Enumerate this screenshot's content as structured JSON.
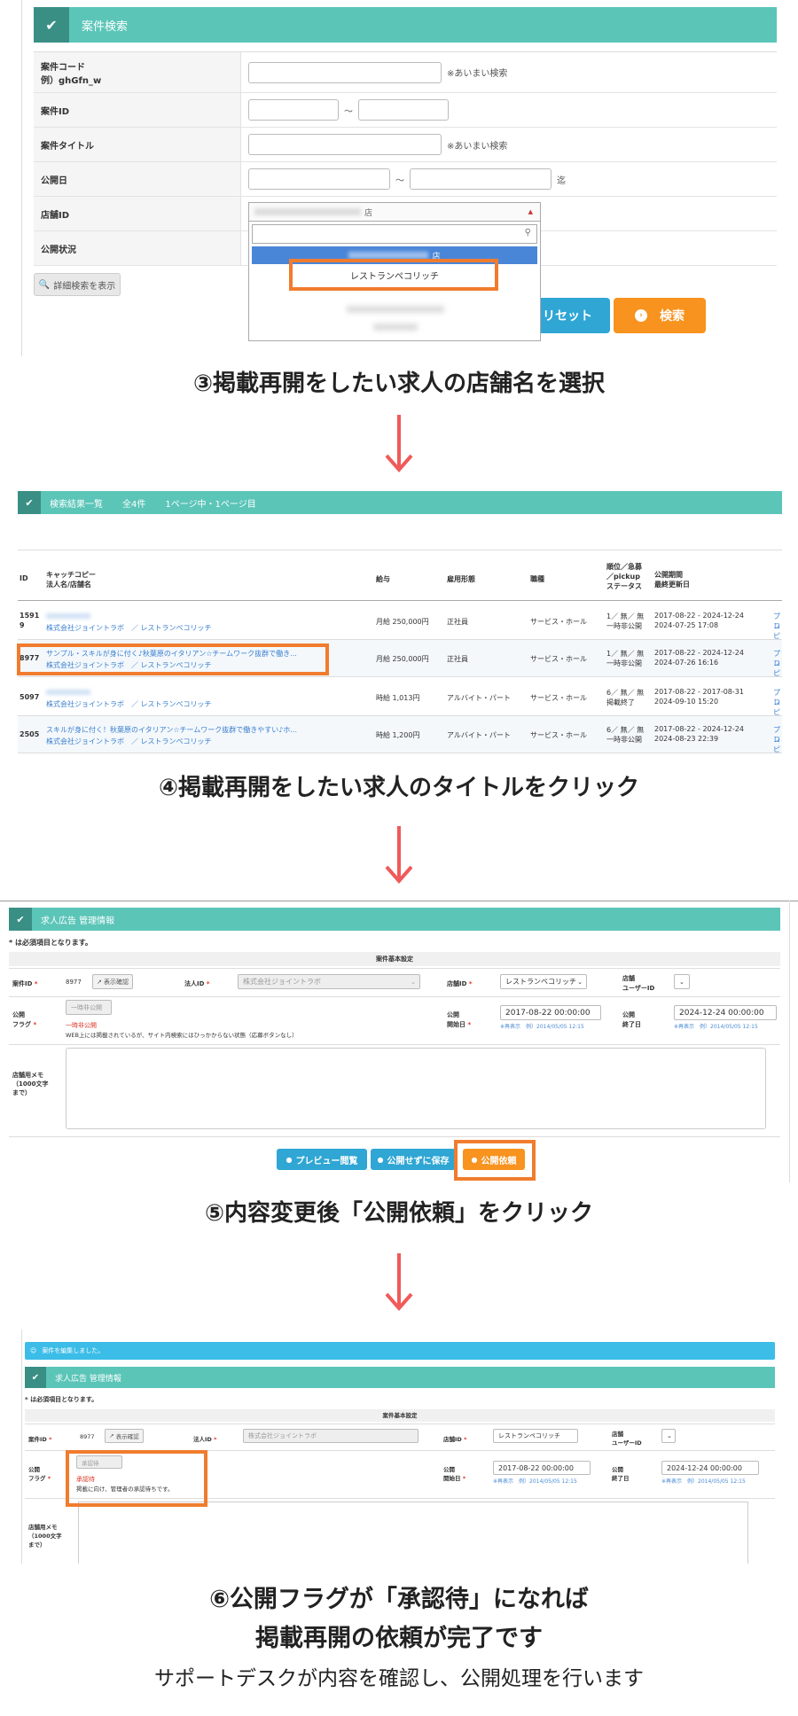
{
  "section1": {
    "header": "案件検索",
    "rows": [
      {
        "label": "案件コード",
        "label2": "例）ghGfn_w",
        "note": "※あいまい検索"
      },
      {
        "label": "案件ID",
        "sep": "～"
      },
      {
        "label": "案件タイトル",
        "note": "※あいまい検索"
      },
      {
        "label": "公開日",
        "sep": "～",
        "note": "迄"
      },
      {
        "label": "店舗ID"
      },
      {
        "label": "公開状況"
      }
    ],
    "store_select_value": "店",
    "dropdown_selected": "店",
    "dropdown_option": "レストランペコリッチ",
    "detail_search_button": "詳細検索を表示",
    "reset_button": "リセット",
    "search_button": "検索"
  },
  "caption3": "③掲載再開をしたい求人の店舗名を選択",
  "section2": {
    "header": {
      "title": "検索結果一覧",
      "total": "全4件",
      "pages": "1ページ中・1ページ目"
    },
    "columns": {
      "id": "ID",
      "catch": "キャッチコピー",
      "catch2": "法人名/店舗名",
      "salary": "給与",
      "employment": "雇用形態",
      "job": "職種",
      "rank1": "順位／急募",
      "rank2": "／pickup",
      "rank3": "ステータス",
      "period1": "公開期間",
      "period2": "最終更新日"
    },
    "rows": [
      {
        "id1": "1591",
        "id2": "9",
        "title": "",
        "corp": "株式会社ジョイントラボ　／ レストランペコリッチ",
        "salary": "月給 250,000円",
        "employment": "正社員",
        "job": "サービス・ホール",
        "rank": "1／ 無／ 無",
        "status": "一時非公開",
        "period": "2017-08-22 - 2024-12-24",
        "updated": "2024-07-25 17:08",
        "side": "プレ",
        "side2": "コピ"
      },
      {
        "id1": "8977",
        "id2": "",
        "title": "サンプル・スキルが身に付く♪秋葉原のイタリアン☆チームワーク抜群で働き...",
        "corp": "株式会社ジョイントラボ　／ レストランペコリッチ",
        "salary": "月給 250,000円",
        "employment": "正社員",
        "job": "サービス・ホール",
        "rank": "1／ 無／ 無",
        "status": "一時非公開",
        "period": "2017-08-22 - 2024-12-24",
        "updated": "2024-07-26 16:16",
        "side": "プレ",
        "side2": "コピ"
      },
      {
        "id1": "5097",
        "id2": "",
        "title": "",
        "corp": "株式会社ジョイントラボ　／ レストランペコリッチ",
        "salary": "時給 1,013円",
        "employment": "アルバイト・パート",
        "job": "サービス・ホール",
        "rank": "6／ 無／ 無",
        "status": "掲載終了",
        "period": "2017-08-22 - 2017-08-31",
        "updated": "2024-09-10 15:20",
        "side": "プレ",
        "side2": "コピ"
      },
      {
        "id1": "2505",
        "id2": "",
        "title": "スキルが身に付く！秋葉原のイタリアン☆チームワーク抜群で働きやすい♪ホ...",
        "corp": "株式会社ジョイントラボ　／ レストランペコリッチ",
        "salary": "時給 1,200円",
        "employment": "アルバイト・パート",
        "job": "サービス・ホール",
        "rank": "6／ 無／ 無",
        "status": "一時非公開",
        "period": "2017-08-22 - 2024-12-24",
        "updated": "2024-08-23 22:39",
        "side": "プレ",
        "side2": "コピ"
      }
    ]
  },
  "caption4": "④掲載再開をしたい求人のタイトルをクリック",
  "section3": {
    "header": "求人広告 管理情報",
    "required_note": "* は必須項目となります。",
    "table_title": "案件基本設定",
    "job_id_label": "案件ID",
    "job_id": "8977",
    "view_button": "表示確認",
    "corp_id_label": "法人ID",
    "corp_value": "株式会社ジョイントラボ",
    "store_id_label": "店舗ID",
    "store_value": "レストランペコリッチ",
    "store_user_label1": "店舗",
    "store_user_label2": "ユーザーID",
    "flag_label1": "公開",
    "flag_label2": "フラグ",
    "flag_select": "一時非公開",
    "flag_status": "一時非公開",
    "flag_desc": "WEB上には掲載されているが、サイト内検索にはひっかからない状態（応募ボタンなし）",
    "start_label1": "公開",
    "start_label2": "開始日",
    "start_value": "2017-08-22 00:00:00",
    "end_label1": "公開",
    "end_label2": "終了日",
    "end_value": "2024-12-24 00:00:00",
    "date_hint": "※再表示　例）2014/05/05 12:15",
    "memo_label": "店舗用メモ（1000文字まで）",
    "preview_button": "プレビュー閲覧",
    "save_button": "公開せずに保存",
    "publish_button": "公開依頼"
  },
  "caption5": "⑤内容変更後「公開依頼」をクリック",
  "section4": {
    "alert": "案件を編集しました。",
    "header": "求人広告 管理情報",
    "required_note": "* は必須項目となります。",
    "table_title": "案件基本設定",
    "flag_select": "承認待",
    "flag_status": "承認待",
    "flag_desc": "掲載に向け、管理者の承認待ちです。"
  },
  "caption6_line1": "⑥公開フラグが「承認待」になれば",
  "caption6_line2": "掲載再開の依頼が完了です",
  "caption6_sub": "サポートデスクが内容を確認し、公開処理を行います",
  "colors": {
    "teal": "#5bc5b8",
    "teal_dark": "#3a8f85",
    "orange": "#f7931e",
    "highlight": "#f07c2e",
    "cyan": "#2fa6d4",
    "arrow": "#f05a5a"
  }
}
